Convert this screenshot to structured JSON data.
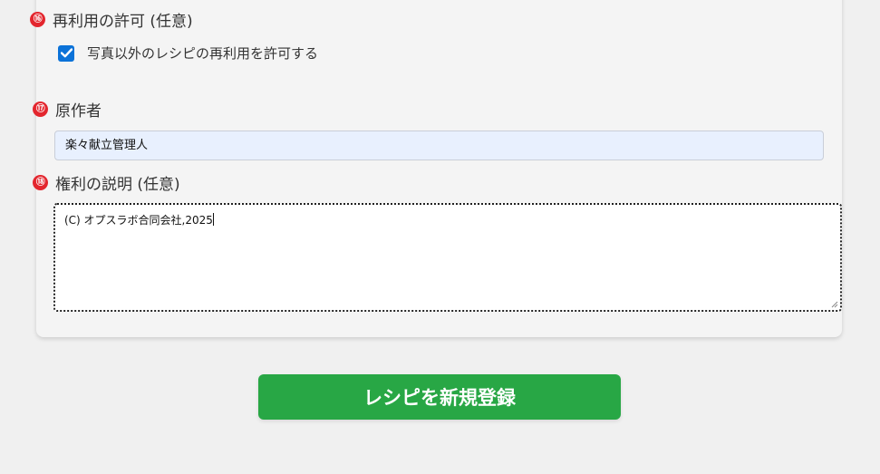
{
  "reuse_section": {
    "marker": "⑯",
    "title": "再利用の許可 (任意)",
    "checkbox_label": "写真以外のレシピの再利用を許可する",
    "checked": true
  },
  "author_section": {
    "marker": "⑰",
    "title": "原作者",
    "value": "楽々献立管理人"
  },
  "rights_section": {
    "marker": "⑱",
    "title": "権利の説明 (任意)",
    "value": "(C) オプスラボ合同会社,2025"
  },
  "submit_button": {
    "label": "レシピを新規登録"
  },
  "colors": {
    "marker": "#e3262e",
    "checkbox": "#0b72d8",
    "input_bg": "#e8f0fe",
    "submit": "#28a745"
  }
}
